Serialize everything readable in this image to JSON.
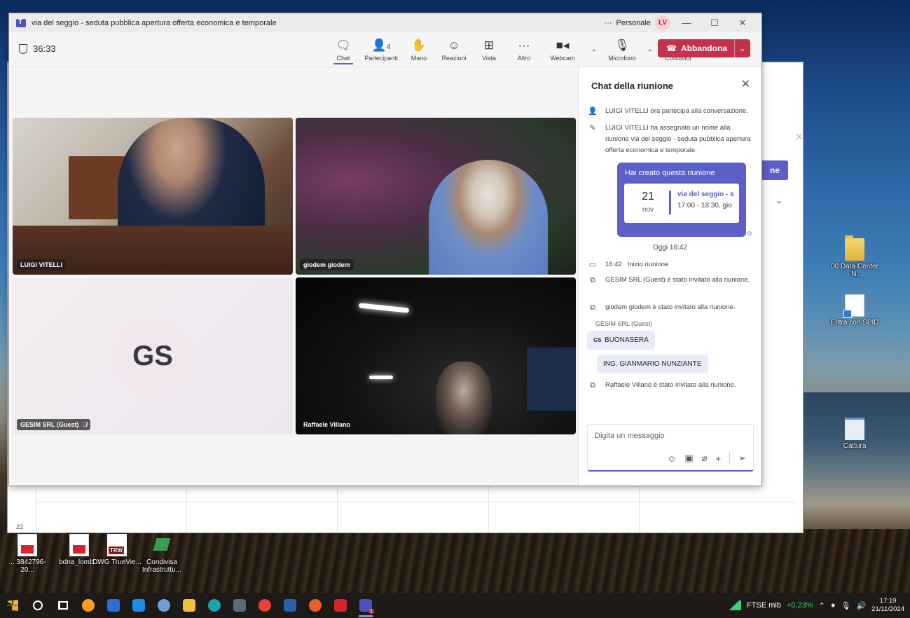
{
  "desktop": {
    "icons_right": [
      {
        "label": "00 Data Center - N..."
      },
      {
        "label": "Entra con SPID"
      },
      {
        "label": "Cattura"
      }
    ],
    "icons_bottom": [
      {
        "label": "... 3842796-20..."
      },
      {
        "label": "bdna_lomb..."
      },
      {
        "label": "DWG TrueVie...",
        "badge": "TRW"
      },
      {
        "label": "Condivisa Infrastruttu..."
      }
    ],
    "back_window": {
      "button_label": "ne",
      "row_number": "22"
    }
  },
  "teams": {
    "title": "via del seggio - seduta pubblica apertura offerta economica e temporale",
    "more_label": "···",
    "profile_label": "Personale",
    "avatar_initials": "LV",
    "timer": "36:33",
    "toolbar": {
      "chat": "Chat",
      "participants": "Partecipanti",
      "participants_count": "4",
      "hand": "Mano",
      "reactions": "Reazioni",
      "view": "Vista",
      "more": "Altro",
      "webcam": "Webcam",
      "microphone": "Microfono",
      "share": "Condividi",
      "leave": "Abbandona"
    },
    "tiles": [
      {
        "name": "LUIGI VITELLI"
      },
      {
        "name": "giodem giodem"
      },
      {
        "name": "GESIM SRL (Guest)",
        "initials": "GS"
      },
      {
        "name": "Raffaele Villano"
      }
    ],
    "chat": {
      "header": "Chat della riunione",
      "sys1": "LUIGI VITELLI ora partecipa alla conversazione.",
      "sys2": "LUIGI VITELLI ha assegnato un nome alla riunione via del seggio - seduta pubblica apertura offerta economica e temporale.",
      "card_title": "Hai creato questa riunione",
      "card_day": "21",
      "card_month": "nov",
      "card_event": "via del seggio - s",
      "card_time": "17:00 - 18:30, gio",
      "day_separator": "Oggi 16:42",
      "sys3_time": "16:42",
      "sys3": "Inizio riunione",
      "sys4": "GESIM SRL (Guest) è stato invitato alla riunione.",
      "sys5": "giodem giodem è stato invitato alla riunione.",
      "sender": "GESIM SRL (Guest)",
      "sender_initials": "GS",
      "msg1": "BUONASERA",
      "msg2": "ING. GIANMARIO NUNZIANTE",
      "sys6": "Raffaele Villano è stato invitato alla riunione.",
      "composer_placeholder": "Digita un messaggio"
    }
  },
  "taskbar": {
    "ftse_label": "FTSE mib",
    "ftse_change": "+0,23%",
    "time": "17:19",
    "date": "21/11/2024",
    "teams_badge": "1"
  },
  "colors": {
    "accent": "#5b5fc7",
    "leave": "#c4314b"
  }
}
